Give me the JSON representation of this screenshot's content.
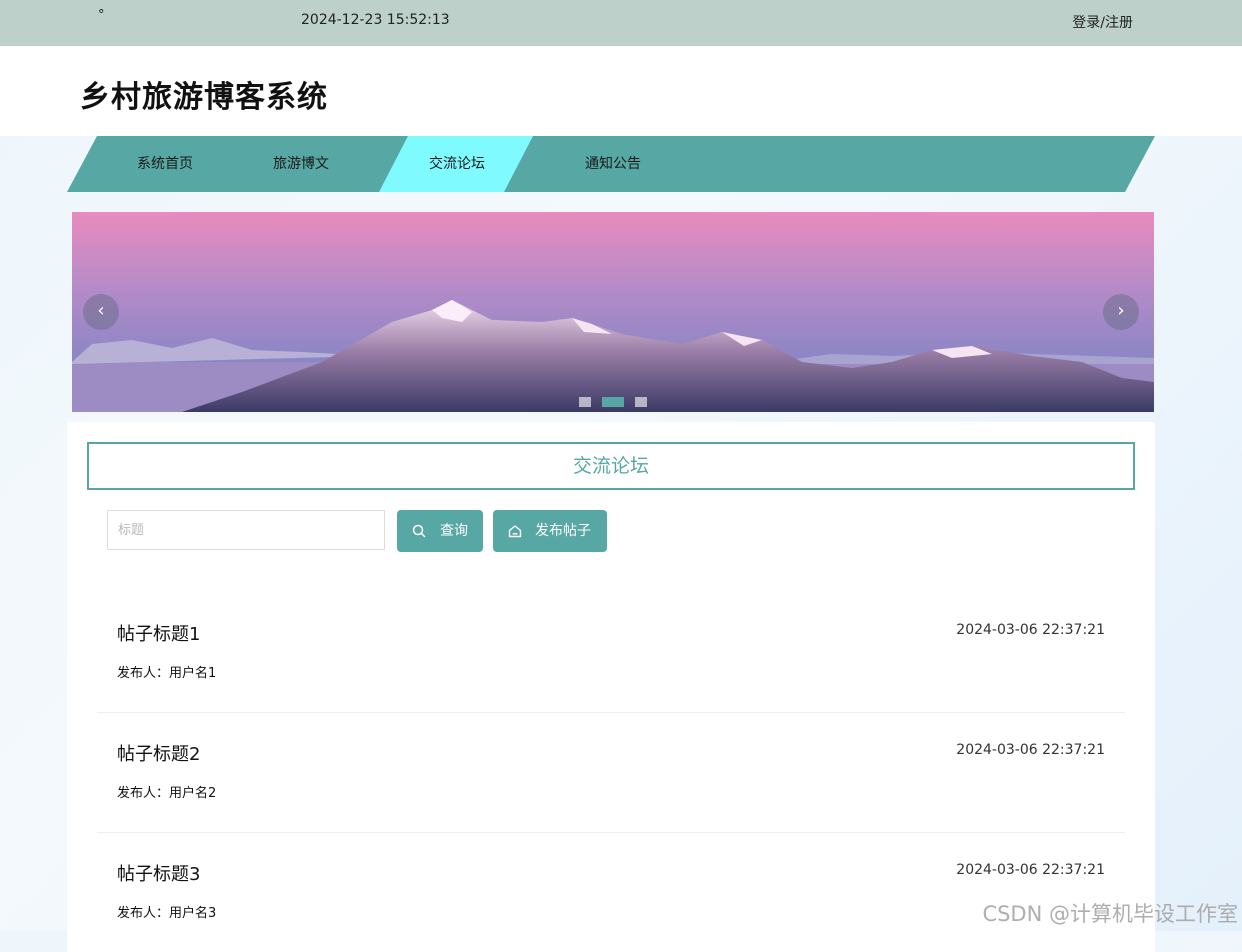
{
  "topbar": {
    "dot": "°",
    "datetime": "2024-12-23 15:52:13",
    "login_label": "登录/注册"
  },
  "header": {
    "site_title": "乡村旅游博客系统"
  },
  "nav": {
    "items": [
      {
        "label": "系统首页"
      },
      {
        "label": "旅游博文"
      },
      {
        "label": "交流论坛",
        "active": true
      },
      {
        "label": "通知公告"
      }
    ],
    "color": "#57a7a4",
    "active_color": "#7ffbff"
  },
  "banner": {
    "prev_icon": "chevron-left-icon",
    "next_icon": "chevron-right-icon",
    "prev_glyph": "‹",
    "next_glyph": "›",
    "slide_count": 3,
    "active_slide": 2
  },
  "forum": {
    "title": "交流论坛",
    "search_placeholder": "标题",
    "search_button": "查询",
    "post_button": "发布帖子",
    "posts": [
      {
        "title": "帖子标题1",
        "date": "2024-03-06 22:37:21",
        "author": "发布人：用户名1"
      },
      {
        "title": "帖子标题2",
        "date": "2024-03-06 22:37:21",
        "author": "发布人：用户名2"
      },
      {
        "title": "帖子标题3",
        "date": "2024-03-06 22:37:21",
        "author": "发布人：用户名3"
      }
    ]
  },
  "watermark": "CSDN @计算机毕设工作室",
  "colors": {
    "accent": "#57a7a4",
    "topbar": "#bdd0ca"
  }
}
